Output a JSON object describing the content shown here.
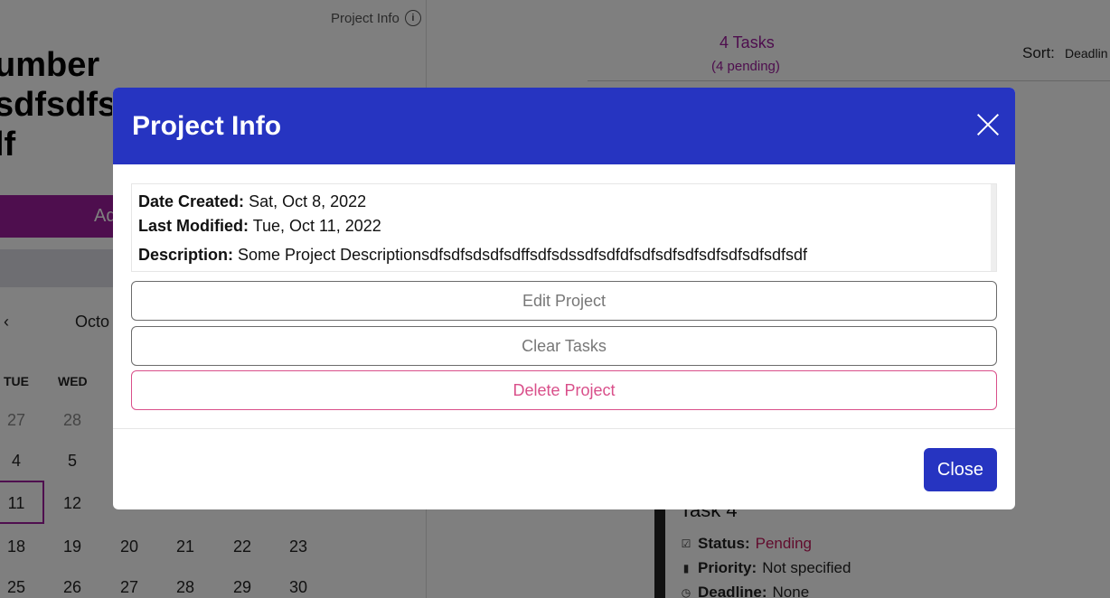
{
  "background": {
    "project_info_link": "Project Info",
    "project_title_lines": [
      "umber",
      "sdfsdfs",
      "lf"
    ],
    "add_button_label": "Ad",
    "calendar": {
      "prev_glyph": "‹",
      "month_label": "Octo",
      "weekday_headers": [
        "TUE",
        "WED"
      ],
      "rows": [
        [
          "27",
          "28"
        ],
        [
          "4",
          "5"
        ],
        [
          "11",
          "12"
        ],
        [
          "18",
          "19",
          "20",
          "21",
          "22",
          "23"
        ],
        [
          "25",
          "26",
          "27",
          "28",
          "29",
          "30"
        ]
      ]
    },
    "tasks_count": "4 Tasks",
    "tasks_pending": "(4 pending)",
    "sort_label": "Sort:",
    "sort_value": "Deadlin",
    "task": {
      "title": "Task 4",
      "status_label": "Status:",
      "status_value": "Pending",
      "priority_label": "Priority:",
      "priority_value": "Not specified",
      "deadline_label": "Deadline:",
      "deadline_value": "None"
    }
  },
  "modal": {
    "title": "Project Info",
    "date_created_label": "Date Created:",
    "date_created_value": "Sat, Oct 8, 2022",
    "last_modified_label": "Last Modified:",
    "last_modified_value": "Tue, Oct 11, 2022",
    "description_label": "Description:",
    "description_value": "Some Project Descriptionsdfsdfsdsdfsdffsdfsdssdfsdfdfsdfsdfsdfsdfsdfsdfsdfsdf",
    "edit_button": "Edit Project",
    "clear_button": "Clear Tasks",
    "delete_button": "Delete Project",
    "close_button": "Close"
  },
  "colors": {
    "modal_header": "#2634c1",
    "accent_purple": "#9c1d9c",
    "delete_pink": "#d94f8a",
    "overlay": "rgba(0,0,0,0.5)"
  }
}
